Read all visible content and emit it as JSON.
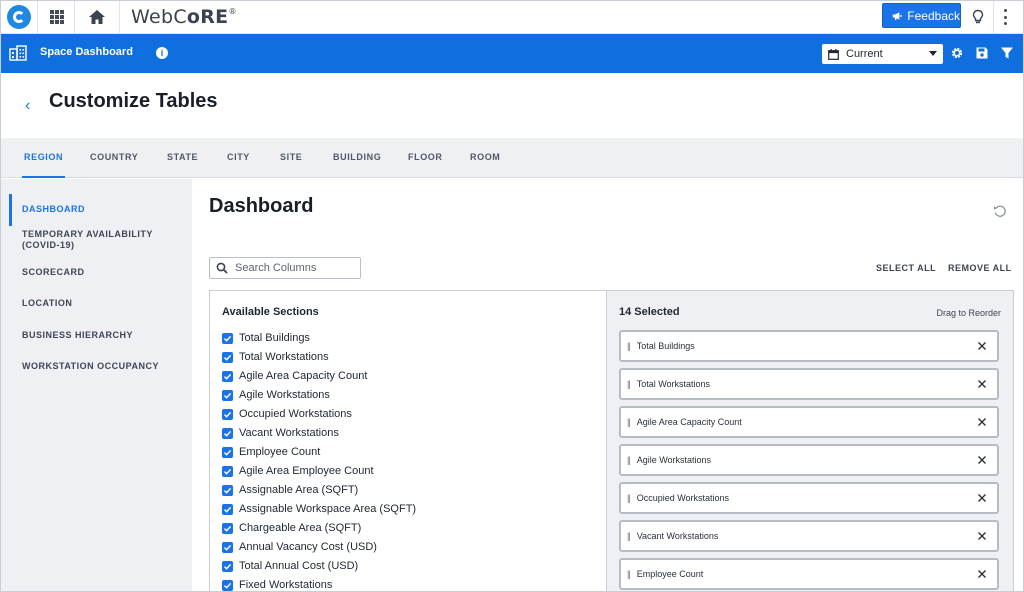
{
  "topbar": {
    "brand_prefix": "WebC",
    "brand_o": "o",
    "brand_suffix": "RE",
    "brand_mark": "®",
    "feedback_label": "Feedback",
    "icons": [
      "app-logo-icon",
      "app-grid-icon",
      "home-icon",
      "megaphone-icon",
      "lightbulb-icon",
      "more-vertical-icon"
    ]
  },
  "toolbar": {
    "title": "Space Dashboard",
    "info_glyph": "i",
    "period_value": "Current",
    "icons": [
      "building-icon",
      "info-icon",
      "calendar-icon",
      "gear-icon",
      "save-icon",
      "filter-icon"
    ]
  },
  "page": {
    "back_glyph": "‹",
    "title": "Customize Tables"
  },
  "tabs": [
    {
      "label": "REGION",
      "active": true
    },
    {
      "label": "COUNTRY"
    },
    {
      "label": "STATE"
    },
    {
      "label": "CITY"
    },
    {
      "label": "SITE"
    },
    {
      "label": "BUILDING"
    },
    {
      "label": "FLOOR"
    },
    {
      "label": "ROOM"
    }
  ],
  "sidenav": [
    {
      "label": "DASHBOARD",
      "active": true
    },
    {
      "label": "TEMPORARY AVAILABILITY (COVID-19)"
    },
    {
      "label": "SCORECARD"
    },
    {
      "label": "LOCATION"
    },
    {
      "label": "BUSINESS HIERARCHY"
    },
    {
      "label": "WORKSTATION OCCUPANCY"
    }
  ],
  "main": {
    "title": "Dashboard",
    "search_placeholder": "Search Columns",
    "select_all": "SELECT ALL",
    "remove_all": "REMOVE ALL"
  },
  "available": {
    "heading": "Available Sections",
    "items": [
      {
        "label": "Total Buildings",
        "checked": true
      },
      {
        "label": "Total Workstations",
        "checked": true
      },
      {
        "label": "Agile Area Capacity Count",
        "checked": true
      },
      {
        "label": "Agile Workstations",
        "checked": true
      },
      {
        "label": "Occupied Workstations",
        "checked": true
      },
      {
        "label": "Vacant Workstations",
        "checked": true
      },
      {
        "label": "Employee Count",
        "checked": true
      },
      {
        "label": "Agile Area Employee Count",
        "checked": true
      },
      {
        "label": "Assignable Area (SQFT)",
        "checked": true
      },
      {
        "label": "Assignable Workspace Area (SQFT)",
        "checked": true
      },
      {
        "label": "Chargeable Area (SQFT)",
        "checked": true
      },
      {
        "label": "Annual Vacancy Cost (USD)",
        "checked": true
      },
      {
        "label": "Total Annual Cost (USD)",
        "checked": true
      },
      {
        "label": "Fixed Workstations",
        "checked": true
      }
    ]
  },
  "selected": {
    "heading": "14 Selected",
    "hint": "Drag to Reorder",
    "grip_glyph": "||",
    "items": [
      {
        "label": "Total Buildings"
      },
      {
        "label": "Total Workstations"
      },
      {
        "label": "Agile Area Capacity Count"
      },
      {
        "label": "Agile Workstations"
      },
      {
        "label": "Occupied Workstations"
      },
      {
        "label": "Vacant Workstations"
      },
      {
        "label": "Employee Count"
      }
    ]
  },
  "colors": {
    "brand_blue": "#0f6fde",
    "accent": "#1a73e8",
    "nav_bg": "#eef0f3"
  }
}
